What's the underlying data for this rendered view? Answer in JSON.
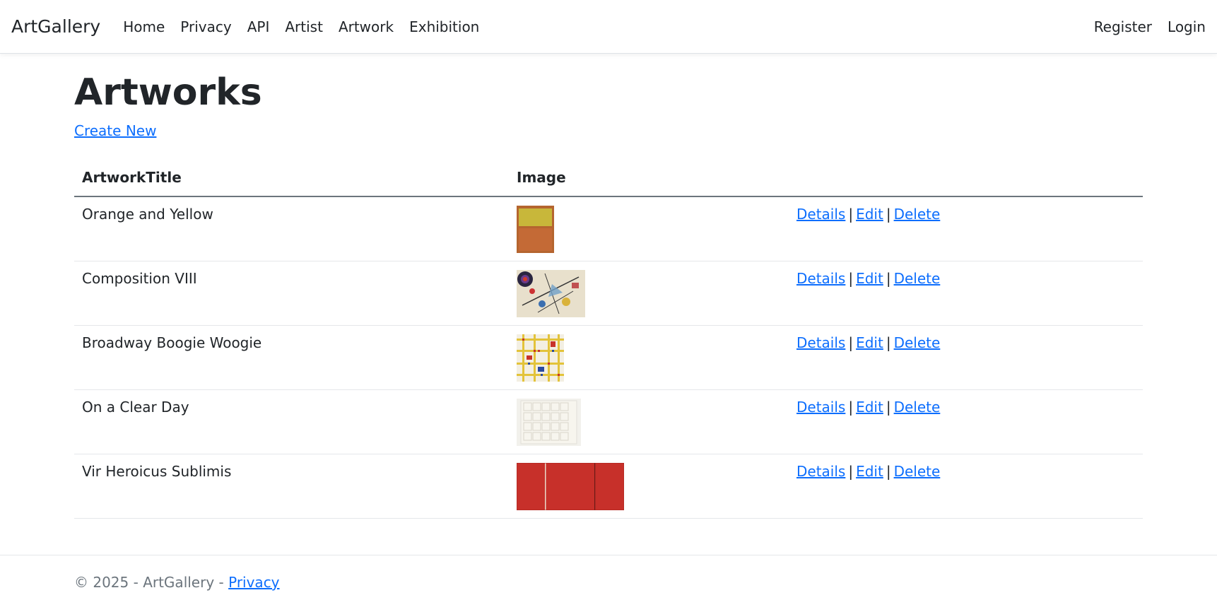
{
  "nav": {
    "brand": "ArtGallery",
    "links": [
      "Home",
      "Privacy",
      "API",
      "Artist",
      "Artwork",
      "Exhibition"
    ],
    "right": [
      "Register",
      "Login"
    ]
  },
  "page": {
    "title": "Artworks",
    "create_new": "Create New"
  },
  "table": {
    "headers": [
      "ArtworkTitle",
      "Image",
      ""
    ],
    "rows": [
      {
        "title": "Orange and Yellow",
        "details": "Details",
        "edit": "Edit",
        "delete": "Delete"
      },
      {
        "title": "Composition VIII",
        "details": "Details",
        "edit": "Edit",
        "delete": "Delete"
      },
      {
        "title": "Broadway Boogie Woogie",
        "details": "Details",
        "edit": "Edit",
        "delete": "Delete"
      },
      {
        "title": "On a Clear Day",
        "details": "Details",
        "edit": "Edit",
        "delete": "Delete"
      },
      {
        "title": "Vir Heroicus Sublimis",
        "details": "Details",
        "edit": "Edit",
        "delete": "Delete"
      }
    ],
    "separator": "|"
  },
  "footer": {
    "text": "© 2025 - ArtGallery - ",
    "privacy": "Privacy"
  },
  "colors": {
    "link": "#0d6efd",
    "text": "#212529",
    "muted": "#6c757d"
  }
}
